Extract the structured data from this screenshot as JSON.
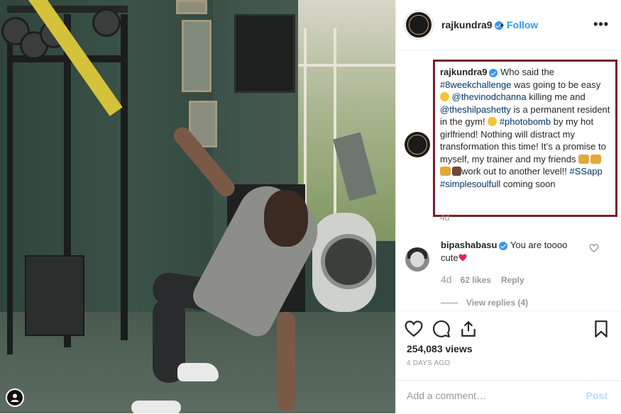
{
  "post": {
    "username": "rajkundra9",
    "follow_sep": "•",
    "follow_label": "Follow",
    "more_label": "•••"
  },
  "caption": {
    "username": "rajkundra9",
    "t1": " Who said the ",
    "tag1": "#8weekchallenge",
    "t2": " was going to be easy ",
    "tag2": "@thevinodchanna",
    "t3": " killing me and ",
    "tag3": "@theshilpashetty",
    "t4": " is a permanent resident in the gym! ",
    "tag4": "#photobomb",
    "t5": " by my hot girlfriend! Nothing will distract my transformation this time! It’s a promise to myself, my trainer and my friends ",
    "t6": "work out to another level!! ",
    "tag5": "#SSapp",
    "tag6": "#simplesoulfull",
    "t7": " coming soon",
    "time": "4d"
  },
  "comment": {
    "username": "bipashabasu",
    "text": "You are toooo cute",
    "time": "4d",
    "likes": "62 likes",
    "reply": "Reply",
    "view_replies": "View replies (4)"
  },
  "stats": {
    "views": "254,083 views",
    "date": "4 DAYS AGO"
  },
  "add_comment": {
    "placeholder": "Add a comment…",
    "post_label": "Post"
  },
  "colors": {
    "link": "#3897f0",
    "highlight_box": "#7a1f2b"
  }
}
